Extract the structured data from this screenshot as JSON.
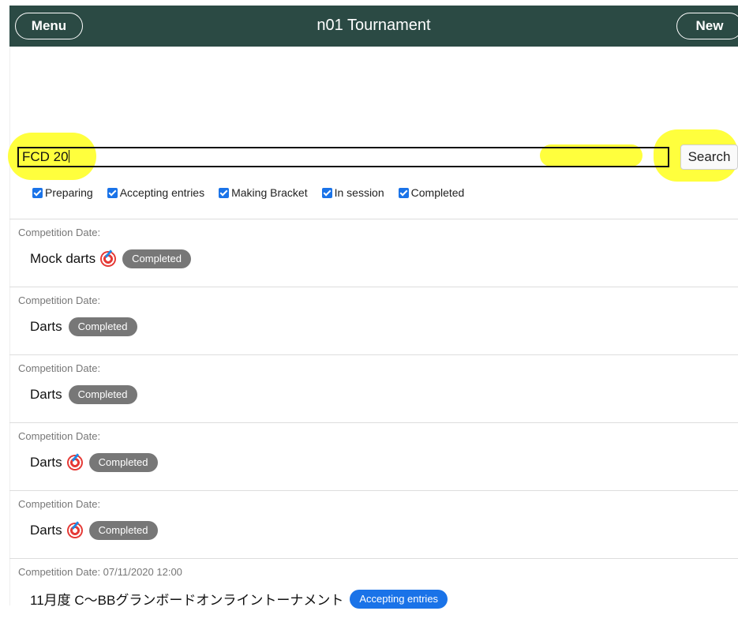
{
  "header": {
    "menu_label": "Menu",
    "title": "n01 Tournament",
    "new_label": "New",
    "background": "#2b4a44"
  },
  "search": {
    "value": "FCD 20",
    "button_label": "Search"
  },
  "filters": [
    {
      "label": "Preparing",
      "checked": true
    },
    {
      "label": "Accepting entries",
      "checked": true
    },
    {
      "label": "Making Bracket",
      "checked": true
    },
    {
      "label": "In session",
      "checked": true
    },
    {
      "label": "Completed",
      "checked": true
    }
  ],
  "tournaments": [
    {
      "date_label": "Competition Date:",
      "name": "Mock darts",
      "has_dart_icon": true,
      "status": "Completed",
      "status_color": "#777777"
    },
    {
      "date_label": "Competition Date:",
      "name": "Darts",
      "has_dart_icon": false,
      "status": "Completed",
      "status_color": "#777777"
    },
    {
      "date_label": "Competition Date:",
      "name": "Darts",
      "has_dart_icon": false,
      "status": "Completed",
      "status_color": "#777777"
    },
    {
      "date_label": "Competition Date:",
      "name": "Darts",
      "has_dart_icon": true,
      "status": "Completed",
      "status_color": "#777777"
    },
    {
      "date_label": "Competition Date:",
      "name": "Darts",
      "has_dart_icon": true,
      "status": "Completed",
      "status_color": "#777777"
    },
    {
      "date_label": "Competition Date: 07/11/2020 12:00",
      "name": "11月度 C〜BBグランボードオンライントーナメント",
      "has_dart_icon": false,
      "status": "Accepting entries",
      "status_color": "#1a73e8"
    }
  ],
  "colors": {
    "highlight": "#ffff33",
    "checkbox": "#1a73e8"
  }
}
